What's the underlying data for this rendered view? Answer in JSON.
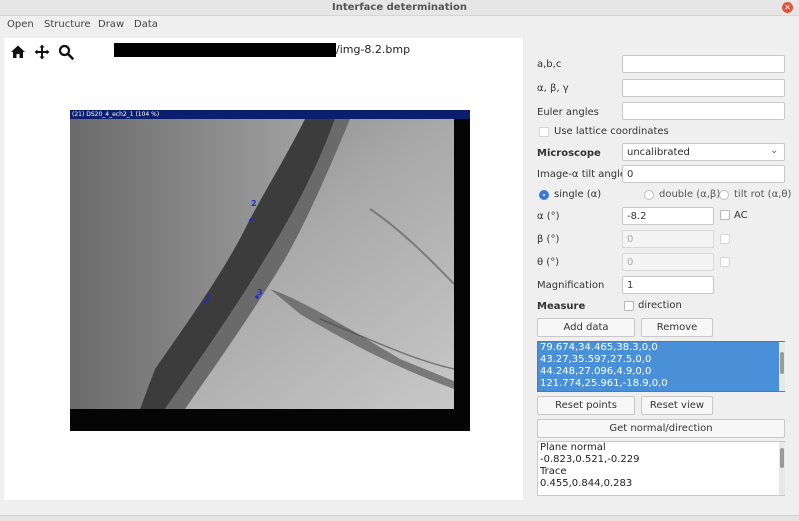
{
  "window": {
    "title": "Interface determination"
  },
  "menu": [
    "Open",
    "Structure",
    "Draw",
    "Data"
  ],
  "toolbar": {
    "icons": [
      "home-icon",
      "move-icon",
      "zoom-icon"
    ]
  },
  "file": {
    "path_suffix": "/img-8.2.bmp"
  },
  "image": {
    "header": "(21) DS20_4_ech2_1 (104 %)",
    "markers": [
      "2",
      "1",
      "3"
    ]
  },
  "panel": {
    "abc_label": "a,b,c",
    "abc_value": "",
    "angles_label": "α, β, γ",
    "angles_value": "",
    "euler_label": "Euler angles",
    "euler_value": "",
    "lattice_label": "Use lattice coordinates",
    "microscope_label": "Microscope",
    "microscope_value": "uncalibrated",
    "tilt_label": "Image-α tilt angle",
    "tilt_value": "0",
    "radio_single": "single (α)",
    "radio_double": "double (α,β)",
    "radio_tiltrot": "tilt rot (α,θ)",
    "alpha_label": "α (°)",
    "alpha_value": "-8.2",
    "ac_label": "AC",
    "beta_label": "β (°)",
    "beta_value": "0",
    "theta_label": "θ (°)",
    "theta_value": "0",
    "magnification_label": "Magnification",
    "magnification_value": "1",
    "measure_label": "Measure",
    "direction_label": "direction",
    "add_data": "Add data",
    "remove": "Remove",
    "data_rows": [
      "79.674,34.465,38.3,0,0",
      "43.27,35.597,27.5,0,0",
      "44.248,27.096,4.9,0,0",
      "121.774,25.961,-18.9,0,0"
    ],
    "reset_points": "Reset points",
    "reset_view": "Reset view",
    "get_normal": "Get normal/direction",
    "output": [
      "Plane normal",
      "-0.823,0.521,-0.229",
      "Trace",
      "0.455,0.844,0.283"
    ]
  },
  "colors": {
    "selection": "#4a90d9",
    "marker": "#1b2fc4",
    "close": "#e2543c"
  }
}
